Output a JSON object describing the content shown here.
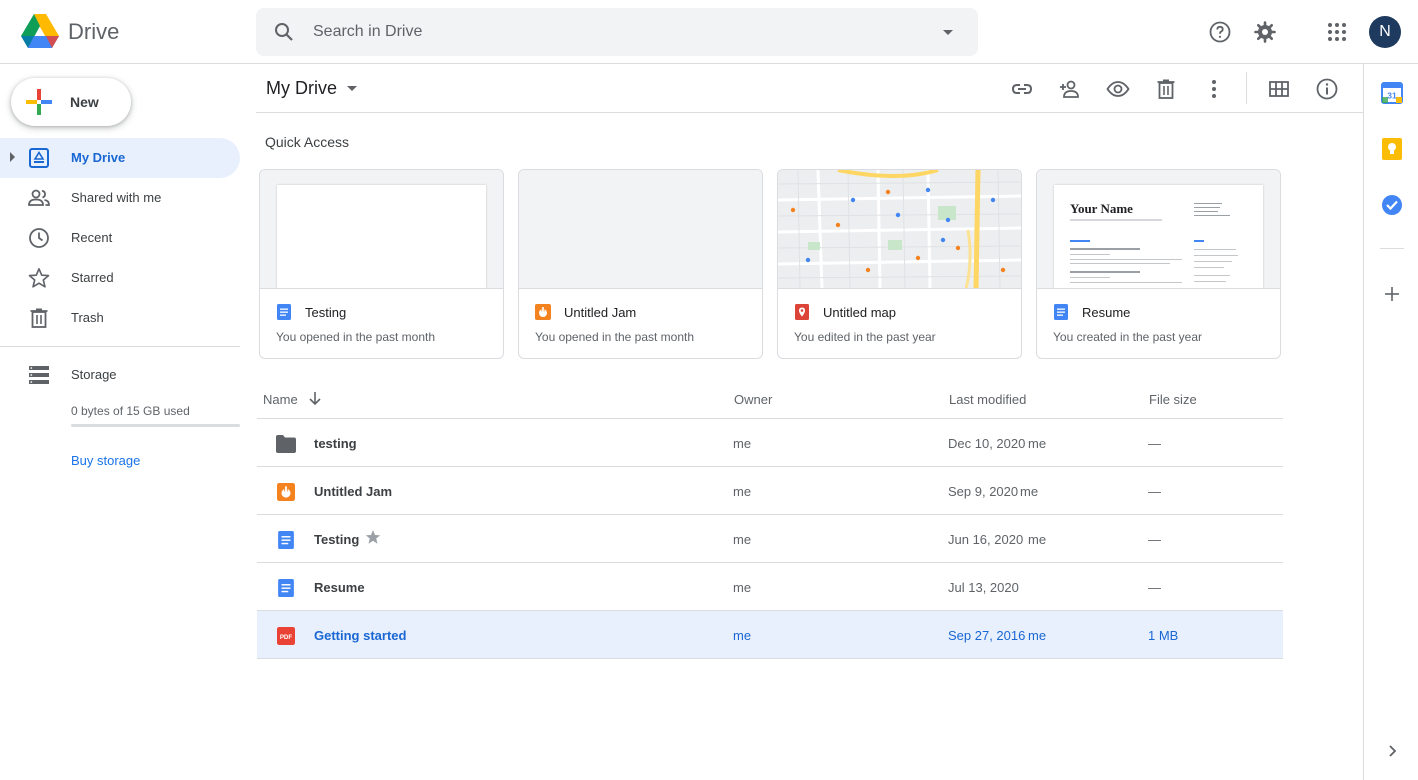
{
  "header": {
    "app_name": "Drive",
    "search_placeholder": "Search in Drive",
    "avatar_letter": "N"
  },
  "sidebar": {
    "new_label": "New",
    "items": [
      {
        "label": "My Drive",
        "icon": "my-drive-icon",
        "active": true
      },
      {
        "label": "Shared with me",
        "icon": "shared-icon"
      },
      {
        "label": "Recent",
        "icon": "clock-icon"
      },
      {
        "label": "Starred",
        "icon": "star-icon"
      },
      {
        "label": "Trash",
        "icon": "trash-icon"
      }
    ],
    "storage_label": "Storage",
    "storage_used": "0 bytes of 15 GB used",
    "buy_storage": "Buy storage"
  },
  "toolbar": {
    "title": "My Drive"
  },
  "quick_access": {
    "title": "Quick Access",
    "cards": [
      {
        "name": "Testing",
        "subtitle": "You opened in the past month",
        "type": "doc"
      },
      {
        "name": "Untitled Jam",
        "subtitle": "You opened in the past month",
        "type": "jam"
      },
      {
        "name": "Untitled map",
        "subtitle": "You edited in the past year",
        "type": "map"
      },
      {
        "name": "Resume",
        "subtitle": "You created in the past year",
        "type": "doc",
        "preview_heading": "Your Name"
      }
    ]
  },
  "file_list": {
    "columns": {
      "name": "Name",
      "owner": "Owner",
      "modified": "Last modified",
      "size": "File size"
    },
    "rows": [
      {
        "name": "testing",
        "type": "folder",
        "owner": "me",
        "modified": "Dec 10, 2020",
        "modified_by": "me",
        "size": "—"
      },
      {
        "name": "Untitled Jam",
        "type": "jam",
        "owner": "me",
        "modified": "Sep 9, 2020",
        "modified_by": "me",
        "size": "—"
      },
      {
        "name": "Testing",
        "type": "doc",
        "owner": "me",
        "modified": "Jun 16, 2020",
        "modified_by": "me",
        "size": "—",
        "starred": true
      },
      {
        "name": "Resume",
        "type": "doc",
        "owner": "me",
        "modified": "Jul 13, 2020",
        "modified_by": "",
        "size": "—"
      },
      {
        "name": "Getting started",
        "type": "pdf",
        "owner": "me",
        "modified": "Sep 27, 2016",
        "modified_by": "me",
        "size": "1 MB",
        "selected": true
      }
    ]
  },
  "colors": {
    "accent": "#1a73e8",
    "selected_bg": "#e8f0fe",
    "doc_blue": "#4285f4",
    "jam_orange": "#f4821f",
    "map_red": "#db4437",
    "pdf_red": "#ea4335"
  }
}
